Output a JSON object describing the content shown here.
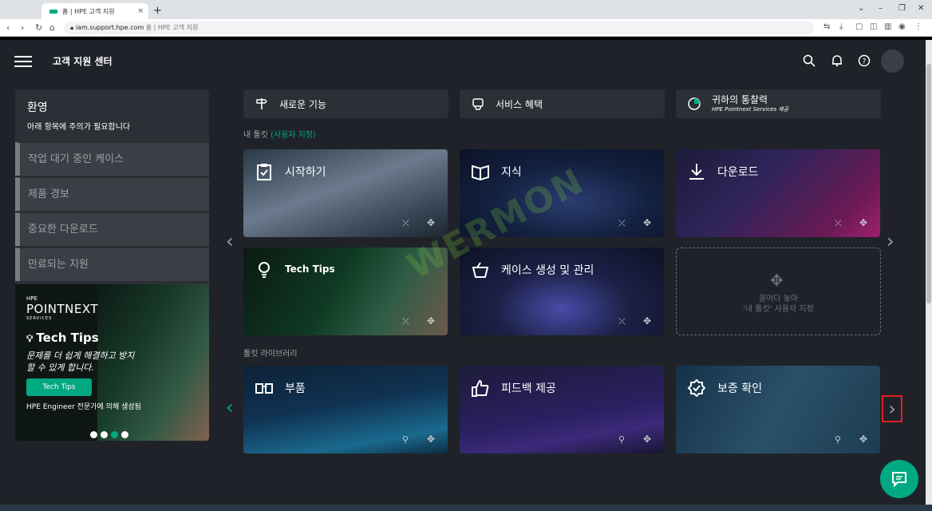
{
  "browser": {
    "tab_title": "홈 | HPE 고객 지원",
    "tab_close": "×",
    "new_tab": "+",
    "url_host": "iam.support.hpe.com",
    "url_rest": " 홈 | HPE 고객 지원"
  },
  "header": {
    "title": "고객 지원 센터"
  },
  "sidebar": {
    "welcome": "환영",
    "welcome_sub": "아래 항목에 주의가 필요합니다",
    "items": [
      {
        "label": "작업 대기 중인 케이스"
      },
      {
        "label": "제품 경보"
      },
      {
        "label": "중요한 다운로드"
      },
      {
        "label": "만료되는 지원"
      }
    ]
  },
  "promo": {
    "brand_top": "HPE",
    "brand_main": "POINTNEXT",
    "brand_sub": "SERVICES",
    "title": "Tech Tips",
    "desc": "문제를 더 쉽게 해결하고 방지할 수 있게 합니다.",
    "button": "Tech Tips",
    "footer": "HPE Engineer 전문가에 의해 생성됨"
  },
  "top_links": [
    {
      "label": "새로운 기능",
      "icon": "signpost-icon"
    },
    {
      "label": "서비스 혜택",
      "icon": "service-icon"
    },
    {
      "label": "귀하의 통찰력",
      "sub": "HPE Pointnext Services 제공",
      "icon": "insights-icon"
    }
  ],
  "sections": {
    "my_tools": "내 툴킷",
    "my_tools_accent": "(사용자 지정)",
    "library": "툴킷 라이브러리"
  },
  "my_tiles": [
    {
      "label": "시작하기",
      "icon": "clipboard-check-icon"
    },
    {
      "label": "지식",
      "icon": "book-icon"
    },
    {
      "label": "다운로드",
      "icon": "download-icon"
    },
    {
      "label": "Tech Tips",
      "icon": "lightbulb-icon"
    },
    {
      "label": "케이스 생성 및 관리",
      "icon": "basket-icon"
    }
  ],
  "dropzone": {
    "line1": "끌어다 놓아",
    "line2": "'내 툴킷' 사용자 지정"
  },
  "library_tiles": [
    {
      "label": "부품",
      "icon": "parts-icon"
    },
    {
      "label": "피드백 제공",
      "icon": "thumbs-up-icon"
    },
    {
      "label": "보증 확인",
      "icon": "badge-check-icon"
    }
  ]
}
